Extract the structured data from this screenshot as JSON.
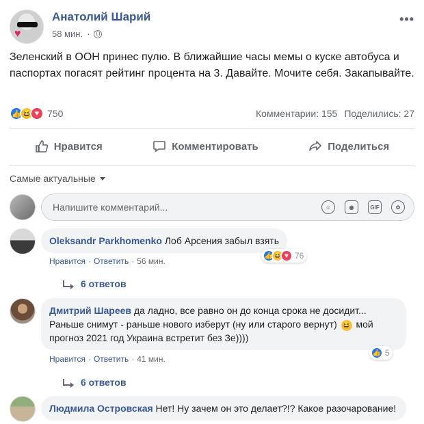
{
  "post": {
    "author": "Анатолий Шарий",
    "time": "58 мин.",
    "text": "Зеленский в ООН принес пулю. В ближайшие часы мемы о куске автобуса и паспортах погасят рейтинг процента на 3. Давайте. Мочите себя. Закапывайте.",
    "reactions_count": "750",
    "comments_count": "Комментарии: 155",
    "shares_count": "Поделились: 27"
  },
  "actions": {
    "like": "Нравится",
    "comment": "Комментировать",
    "share": "Поделиться"
  },
  "sort_label": "Самые актуальные",
  "composer": {
    "placeholder": "Напишите комментарий..."
  },
  "comments": [
    {
      "author": "Oleksandr Parkhomenko",
      "text": "Лоб Арсения забыл взять",
      "like": "Нравится",
      "reply": "Ответить",
      "time": "56 мин.",
      "reactions": "76",
      "replies": "6 ответов"
    },
    {
      "author": "Дмитрий Шареев",
      "text_before": "да ладно, все равно он до конца срока не досидит... Раньше снимут - раньше нового изберут (ну или старого вернут)",
      "text_after": "мой прогноз 2021 год Украина встретит без Зе))))",
      "like": "Нравится",
      "reply": "Ответить",
      "time": "41 мин.",
      "reactions": "5",
      "replies": "6 ответов"
    },
    {
      "author": "Людмила Островская",
      "text": "Нет! Ну зачем он это делает?!? Какое разочарование!"
    }
  ],
  "colors": {
    "link_blue": "#385898",
    "like_blue": "#2078f4",
    "love_red": "#f33e58",
    "haha_yellow": "#f7c33b",
    "bubble_bg": "#f2f3f5"
  }
}
